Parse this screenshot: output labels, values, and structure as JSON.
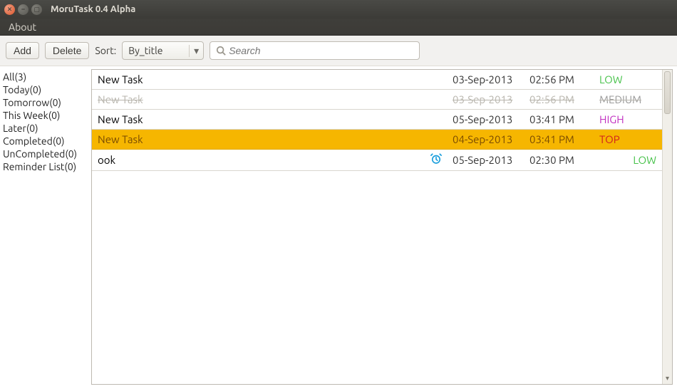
{
  "window": {
    "title": "MoruTask 0.4 Alpha"
  },
  "menubar": {
    "about": "About"
  },
  "toolbar": {
    "add_label": "Add",
    "delete_label": "Delete",
    "sort_label": "Sort:",
    "sort_value": "By_title",
    "search_placeholder": "Search"
  },
  "sidebar": {
    "items": [
      {
        "label": "All(3)"
      },
      {
        "label": "Today(0)"
      },
      {
        "label": "Tomorrow(0)"
      },
      {
        "label": "This Week(0)"
      },
      {
        "label": "Later(0)"
      },
      {
        "label": "Completed(0)"
      },
      {
        "label": "UnCompleted(0)"
      },
      {
        "label": "Reminder List(0)"
      }
    ]
  },
  "tasks": [
    {
      "title": "New Task",
      "date": "03-Sep-2013",
      "time": "02:56 PM",
      "priority": "LOW",
      "prio_class": "prio-low",
      "completed": false,
      "highlight": false,
      "reminder": false
    },
    {
      "title": "New Task",
      "date": "03-Sep-2013",
      "time": "02:56 PM",
      "priority": "MEDIUM",
      "prio_class": "prio-medium",
      "completed": true,
      "highlight": false,
      "reminder": false
    },
    {
      "title": "New Task",
      "date": "05-Sep-2013",
      "time": "03:41 PM",
      "priority": "HIGH",
      "prio_class": "prio-high",
      "completed": false,
      "highlight": false,
      "reminder": false
    },
    {
      "title": "New Task",
      "date": "04-Sep-2013",
      "time": "03:41 PM",
      "priority": "TOP",
      "prio_class": "prio-top",
      "completed": false,
      "highlight": true,
      "reminder": false
    },
    {
      "title": "ook",
      "date": "05-Sep-2013",
      "time": "02:30 PM",
      "priority": "LOW",
      "prio_class": "prio-low",
      "completed": false,
      "highlight": false,
      "reminder": true
    }
  ]
}
